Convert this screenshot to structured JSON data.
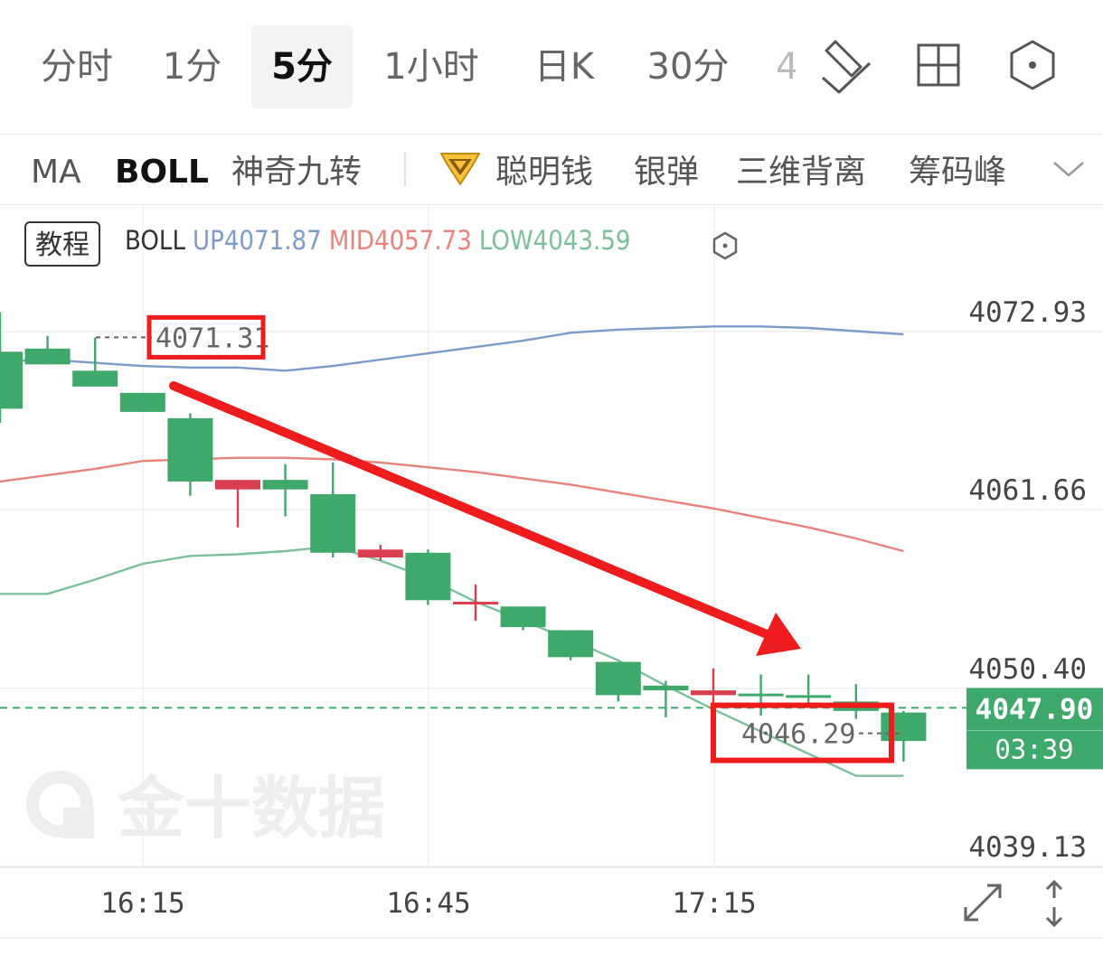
{
  "period_tabs": [
    "分时",
    "1分",
    "5分",
    "1小时",
    "日K",
    "30分",
    "4"
  ],
  "active_period": "5分",
  "indicator_tabs": {
    "ma": "MA",
    "boll": "BOLL",
    "magic9": "神奇九转",
    "smart_money": "聪明钱",
    "silver_bullet": "银弹",
    "divergence3d": "三维背离",
    "chip_peak": "筹码峰"
  },
  "legend": {
    "tutorial": "教程",
    "name": "BOLL",
    "up": "UP4071.87",
    "mid": "MID4057.73",
    "low": "LOW4043.59"
  },
  "colors": {
    "up_line": "#7d9ccc",
    "mid_line": "#e8847c",
    "low_line": "#7cc09a",
    "bull": "#d93f4e",
    "bear": "#3fa86b",
    "annotation": "#ee1c1c"
  },
  "watermark": "金十数据",
  "chart_data": {
    "type": "candlestick",
    "interval": "5分",
    "x_ticks": [
      "16:15",
      "16:45",
      "17:15"
    ],
    "y_ticks": [
      4072.93,
      4061.66,
      4050.4,
      4039.13
    ],
    "ylim": [
      4039.13,
      4072.93
    ],
    "candles": [
      {
        "o": 4070.4,
        "h": 4072.9,
        "l": 4065.9,
        "c": 4066.8
      },
      {
        "o": 4070.6,
        "h": 4071.4,
        "l": 4069.6,
        "c": 4069.6
      },
      {
        "o": 4069.2,
        "h": 4071.3,
        "l": 4068.2,
        "c": 4068.2
      },
      {
        "o": 4067.8,
        "h": 4067.8,
        "l": 4066.6,
        "c": 4066.6
      },
      {
        "o": 4066.2,
        "h": 4066.5,
        "l": 4061.3,
        "c": 4062.2
      },
      {
        "o": 4061.7,
        "h": 4062.3,
        "l": 4059.3,
        "c": 4062.3
      },
      {
        "o": 4062.3,
        "h": 4063.3,
        "l": 4060.0,
        "c": 4061.7
      },
      {
        "o": 4061.4,
        "h": 4063.4,
        "l": 4057.4,
        "c": 4057.7
      },
      {
        "o": 4057.4,
        "h": 4058.2,
        "l": 4057.2,
        "c": 4057.9
      },
      {
        "o": 4057.7,
        "h": 4057.9,
        "l": 4054.4,
        "c": 4054.7
      },
      {
        "o": 4054.6,
        "h": 4055.7,
        "l": 4053.4,
        "c": 4054.6
      },
      {
        "o": 4054.3,
        "h": 4054.3,
        "l": 4052.8,
        "c": 4053.0
      },
      {
        "o": 4052.8,
        "h": 4052.8,
        "l": 4050.9,
        "c": 4051.1
      },
      {
        "o": 4050.8,
        "h": 4050.8,
        "l": 4048.3,
        "c": 4048.7
      },
      {
        "o": 4049.3,
        "h": 4049.6,
        "l": 4047.3,
        "c": 4049.0
      },
      {
        "o": 4048.7,
        "h": 4050.4,
        "l": 4048.2,
        "c": 4049.0
      },
      {
        "o": 4048.8,
        "h": 4050.0,
        "l": 4047.4,
        "c": 4048.7
      },
      {
        "o": 4048.7,
        "h": 4050.0,
        "l": 4047.9,
        "c": 4048.6
      },
      {
        "o": 4048.3,
        "h": 4049.4,
        "l": 4047.2,
        "c": 4047.7
      },
      {
        "o": 4047.6,
        "h": 4047.7,
        "l": 4044.5,
        "c": 4045.8
      }
    ],
    "bands": {
      "up": [
        4069.8,
        4069.9,
        4069.7,
        4069.5,
        4069.4,
        4069.4,
        4069.2,
        4069.5,
        4069.9,
        4070.3,
        4070.7,
        4071.1,
        4071.6,
        4071.8,
        4071.9,
        4072.0,
        4072.0,
        4071.9,
        4071.7,
        4071.5
      ],
      "mid": [
        4062.2,
        4062.6,
        4063.0,
        4063.5,
        4063.6,
        4063.7,
        4063.7,
        4063.6,
        4063.4,
        4063.1,
        4062.8,
        4062.4,
        4062.0,
        4061.5,
        4061.0,
        4060.5,
        4059.9,
        4059.3,
        4058.6,
        4057.8
      ],
      "low": [
        4055.1,
        4055.1,
        4056.0,
        4057.0,
        4057.5,
        4057.6,
        4057.8,
        4058.1,
        4057.2,
        4056.1,
        4054.6,
        4053.4,
        4052.2,
        4050.9,
        4049.3,
        4047.8,
        4046.4,
        4045.0,
        4043.6,
        4043.6
      ]
    },
    "current_price": "4047.90",
    "countdown": "03:39",
    "high_label": "4071.31",
    "low_label": "4046.29"
  }
}
